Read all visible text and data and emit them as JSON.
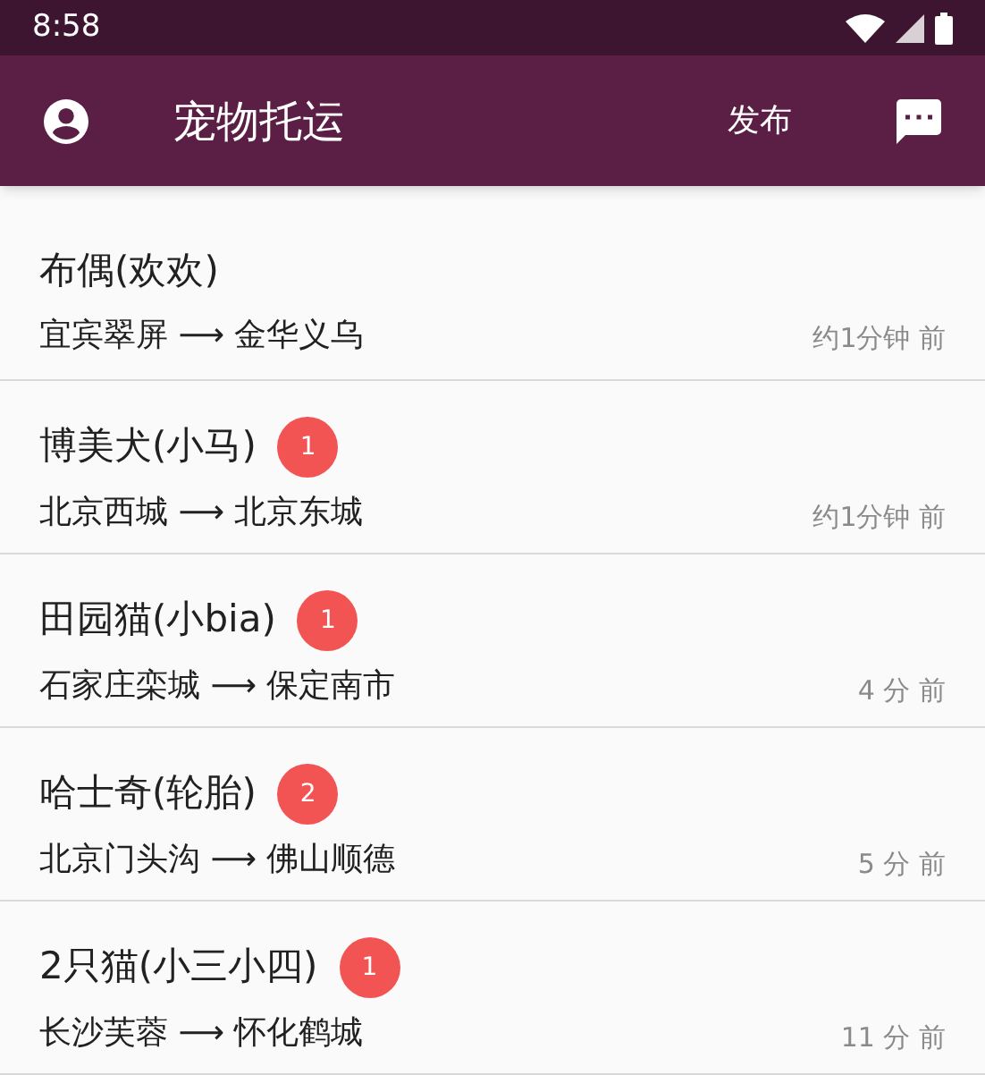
{
  "status_bar": {
    "time": "8:58"
  },
  "app_bar": {
    "title": "宠物托运",
    "action": "发布"
  },
  "items": [
    {
      "title": "布偶(欢欢)",
      "route": "宜宾翠屏 ⟶ 金华义乌",
      "time": "约1分钟 前"
    },
    {
      "title": "博美犬(小马)",
      "badge": "1",
      "route": "北京西城 ⟶ 北京东城",
      "time": "约1分钟 前"
    },
    {
      "title": "田园猫(小bia)",
      "badge": "1",
      "route": "石家庄栾城 ⟶ 保定南市",
      "time": "4 分 前"
    },
    {
      "title": "哈士奇(轮胎)",
      "badge": "2",
      "route": "北京门头沟 ⟶ 佛山顺德",
      "time": "5 分 前"
    },
    {
      "title": "2只猫(小三小四)",
      "badge": "1",
      "route": "长沙芙蓉 ⟶ 怀化鹤城",
      "time": "11 分 前"
    }
  ]
}
